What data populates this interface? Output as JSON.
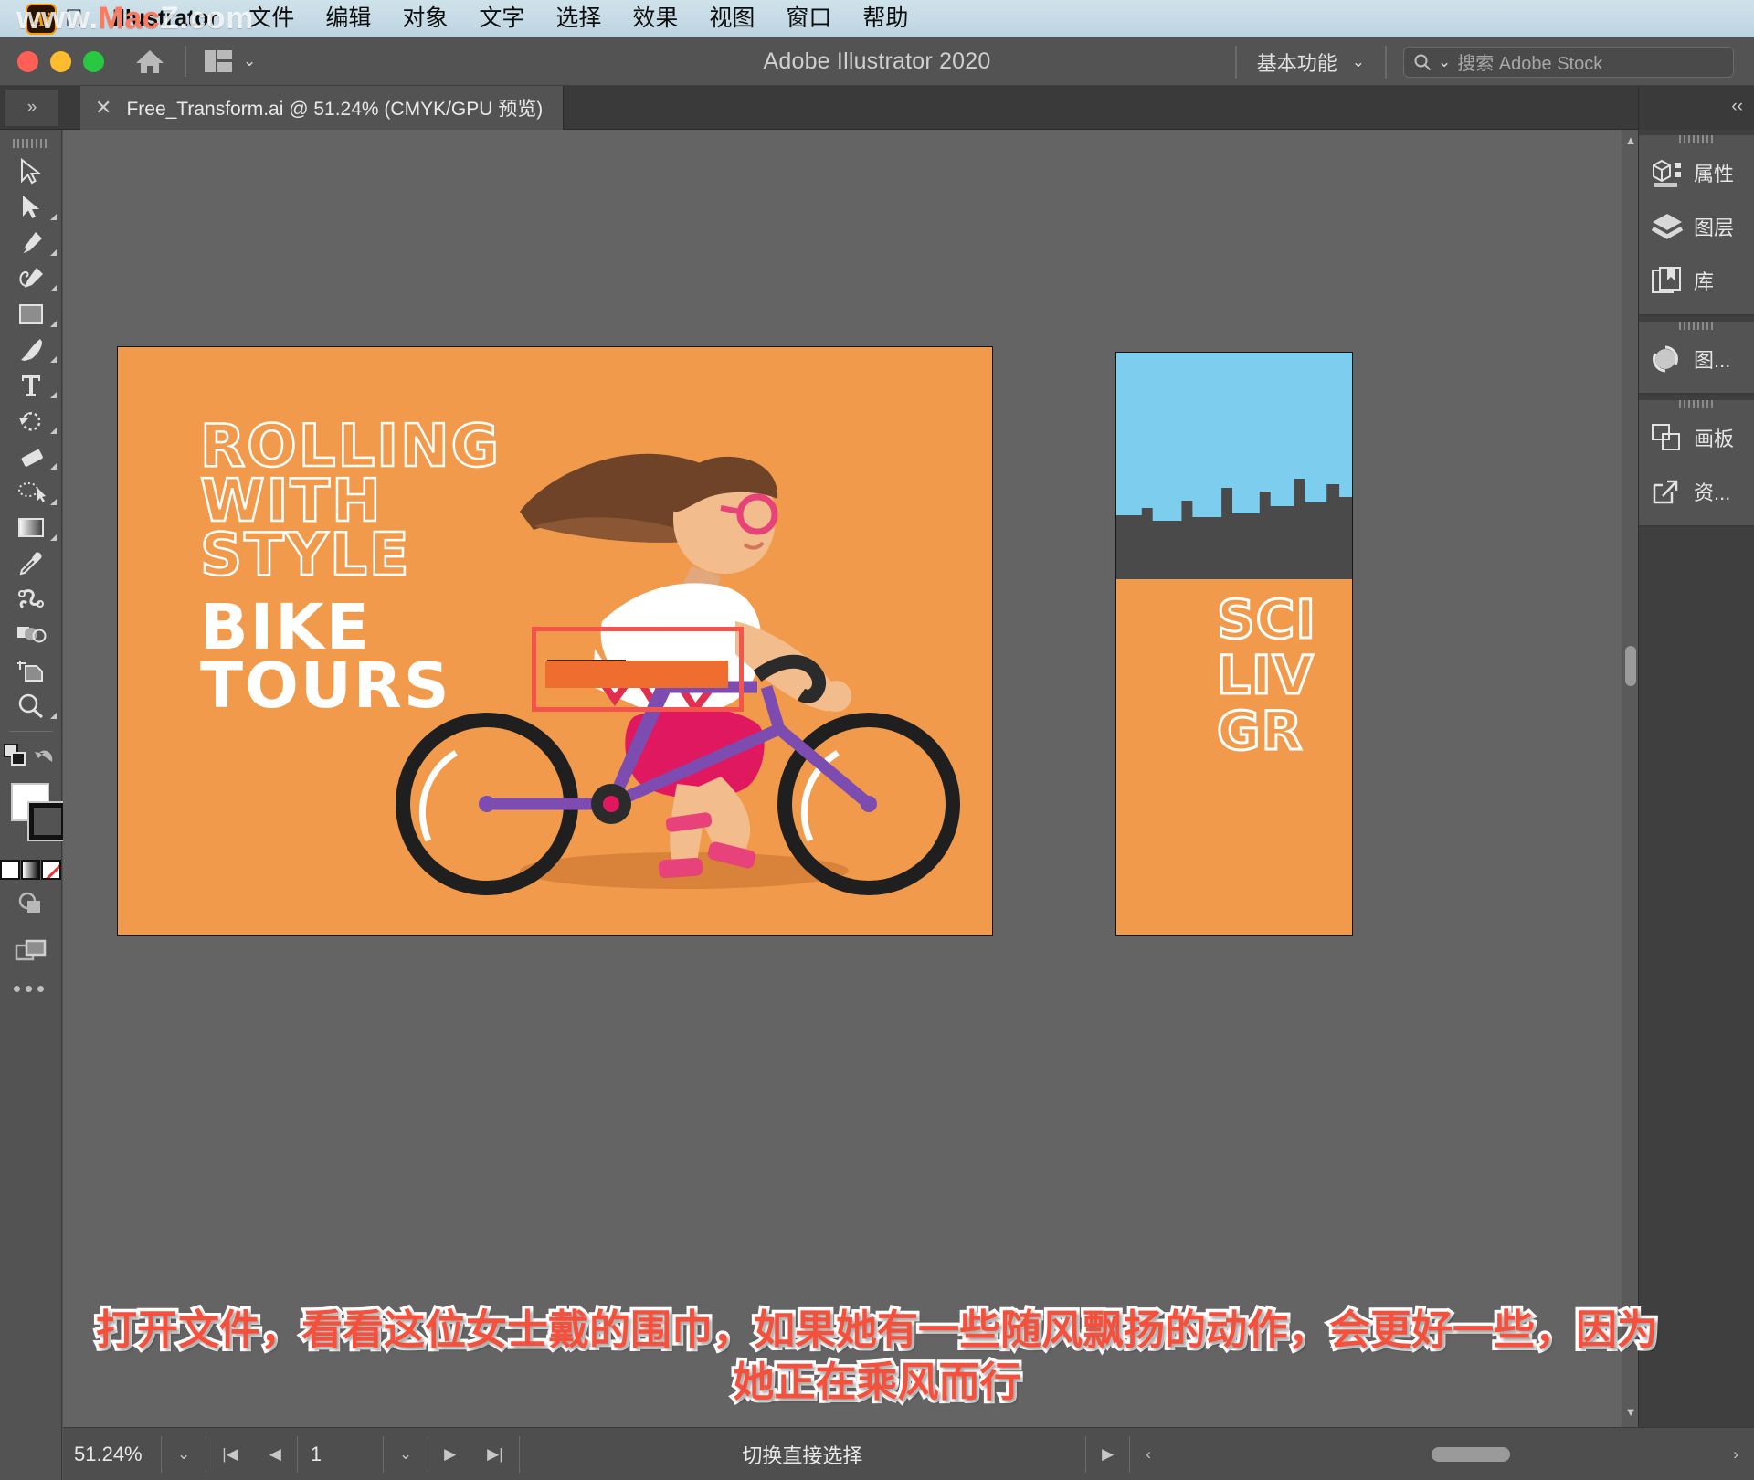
{
  "mac_menu": {
    "watermark": "www.MacZ.com",
    "app_name": "Illustrator",
    "items": [
      "文件",
      "编辑",
      "对象",
      "文字",
      "选择",
      "效果",
      "视图",
      "窗口",
      "帮助"
    ]
  },
  "titlebar": {
    "app_title": "Adobe Illustrator 2020",
    "workspace": "基本功能",
    "search_placeholder": "搜索 Adobe Stock",
    "home_icon": "home-icon",
    "arrange_icon": "arrange-documents-icon",
    "chevron": "⌄"
  },
  "tabbar": {
    "close": "✕",
    "doc_name": "Free_Transform.ai @ 51.24% (CMYK/GPU 预览)",
    "collapse_left": "»",
    "collapse_right": "‹‹"
  },
  "toolbar": {
    "tools": [
      {
        "name": "selection-tool",
        "has_flyout": false
      },
      {
        "name": "direct-selection-tool",
        "has_flyout": true
      },
      {
        "name": "pen-tool",
        "has_flyout": true
      },
      {
        "name": "curvature-tool",
        "has_flyout": true
      },
      {
        "name": "rectangle-tool",
        "has_flyout": true
      },
      {
        "name": "paintbrush-tool",
        "has_flyout": true
      },
      {
        "name": "type-tool",
        "has_flyout": true
      },
      {
        "name": "rotate-tool",
        "has_flyout": true
      },
      {
        "name": "eraser-tool",
        "has_flyout": true
      },
      {
        "name": "lasso-tool",
        "has_flyout": true
      },
      {
        "name": "gradient-tool",
        "has_flyout": true
      },
      {
        "name": "eyedropper-tool",
        "has_flyout": true
      },
      {
        "name": "blend-tool",
        "has_flyout": false
      },
      {
        "name": "shape-builder-tool",
        "has_flyout": true
      },
      {
        "name": "artboard-tool",
        "has_flyout": false
      },
      {
        "name": "zoom-tool",
        "has_flyout": true
      }
    ],
    "swap_fill_stroke": "swap-fill-stroke-icon",
    "default_fill_stroke": "default-fill-stroke-icon",
    "fill_color": "#ffffff",
    "stroke_color": "#111111",
    "color_modes": [
      "solid-color",
      "gradient",
      "none"
    ],
    "drawing_mode": "draw-normal-icon",
    "screen_mode": "screen-mode-icon",
    "more_tools": "•••"
  },
  "artwork": {
    "artboard1": {
      "background": "#f19a4b",
      "title_outline_lines": [
        "ROLLING",
        "WITH",
        "STYLE"
      ],
      "title_solid_lines": [
        "BIKE",
        "TOURS"
      ],
      "selection_color": "#f4544a",
      "scarf_color": "#ef6d2e"
    },
    "artboard2": {
      "background": "#f19a4b",
      "sky_color": "#7dcdef",
      "city_color": "#4a4a4a",
      "text_lines": [
        "SCI",
        "LIV",
        "GR"
      ]
    }
  },
  "right_dock": {
    "groups": [
      {
        "items": [
          {
            "label": "属性",
            "icon": "properties-icon"
          },
          {
            "label": "图层",
            "icon": "layers-icon"
          },
          {
            "label": "库",
            "icon": "libraries-icon"
          }
        ]
      },
      {
        "items": [
          {
            "label": "图...",
            "icon": "image-trace-icon"
          }
        ]
      },
      {
        "items": [
          {
            "label": "画板",
            "icon": "artboards-icon"
          },
          {
            "label": "资...",
            "icon": "asset-export-icon"
          }
        ]
      }
    ]
  },
  "statusbar": {
    "zoom": "51.24%",
    "zoom_chevron": "⌄",
    "first_page": "|◀",
    "prev_page": "◀",
    "page": "1",
    "page_chevron": "⌄",
    "next_page": "▶",
    "last_page": "▶|",
    "status_text": "切换直接选择",
    "nav_right": "▶",
    "nav_left": "‹",
    "scroll_right": "›"
  },
  "subtitles": {
    "line1": "打开文件，看看这位女士戴的围巾，如果她有一些随风飘扬的动作，会更好一些，因为",
    "line2": "她正在乘风而行"
  }
}
